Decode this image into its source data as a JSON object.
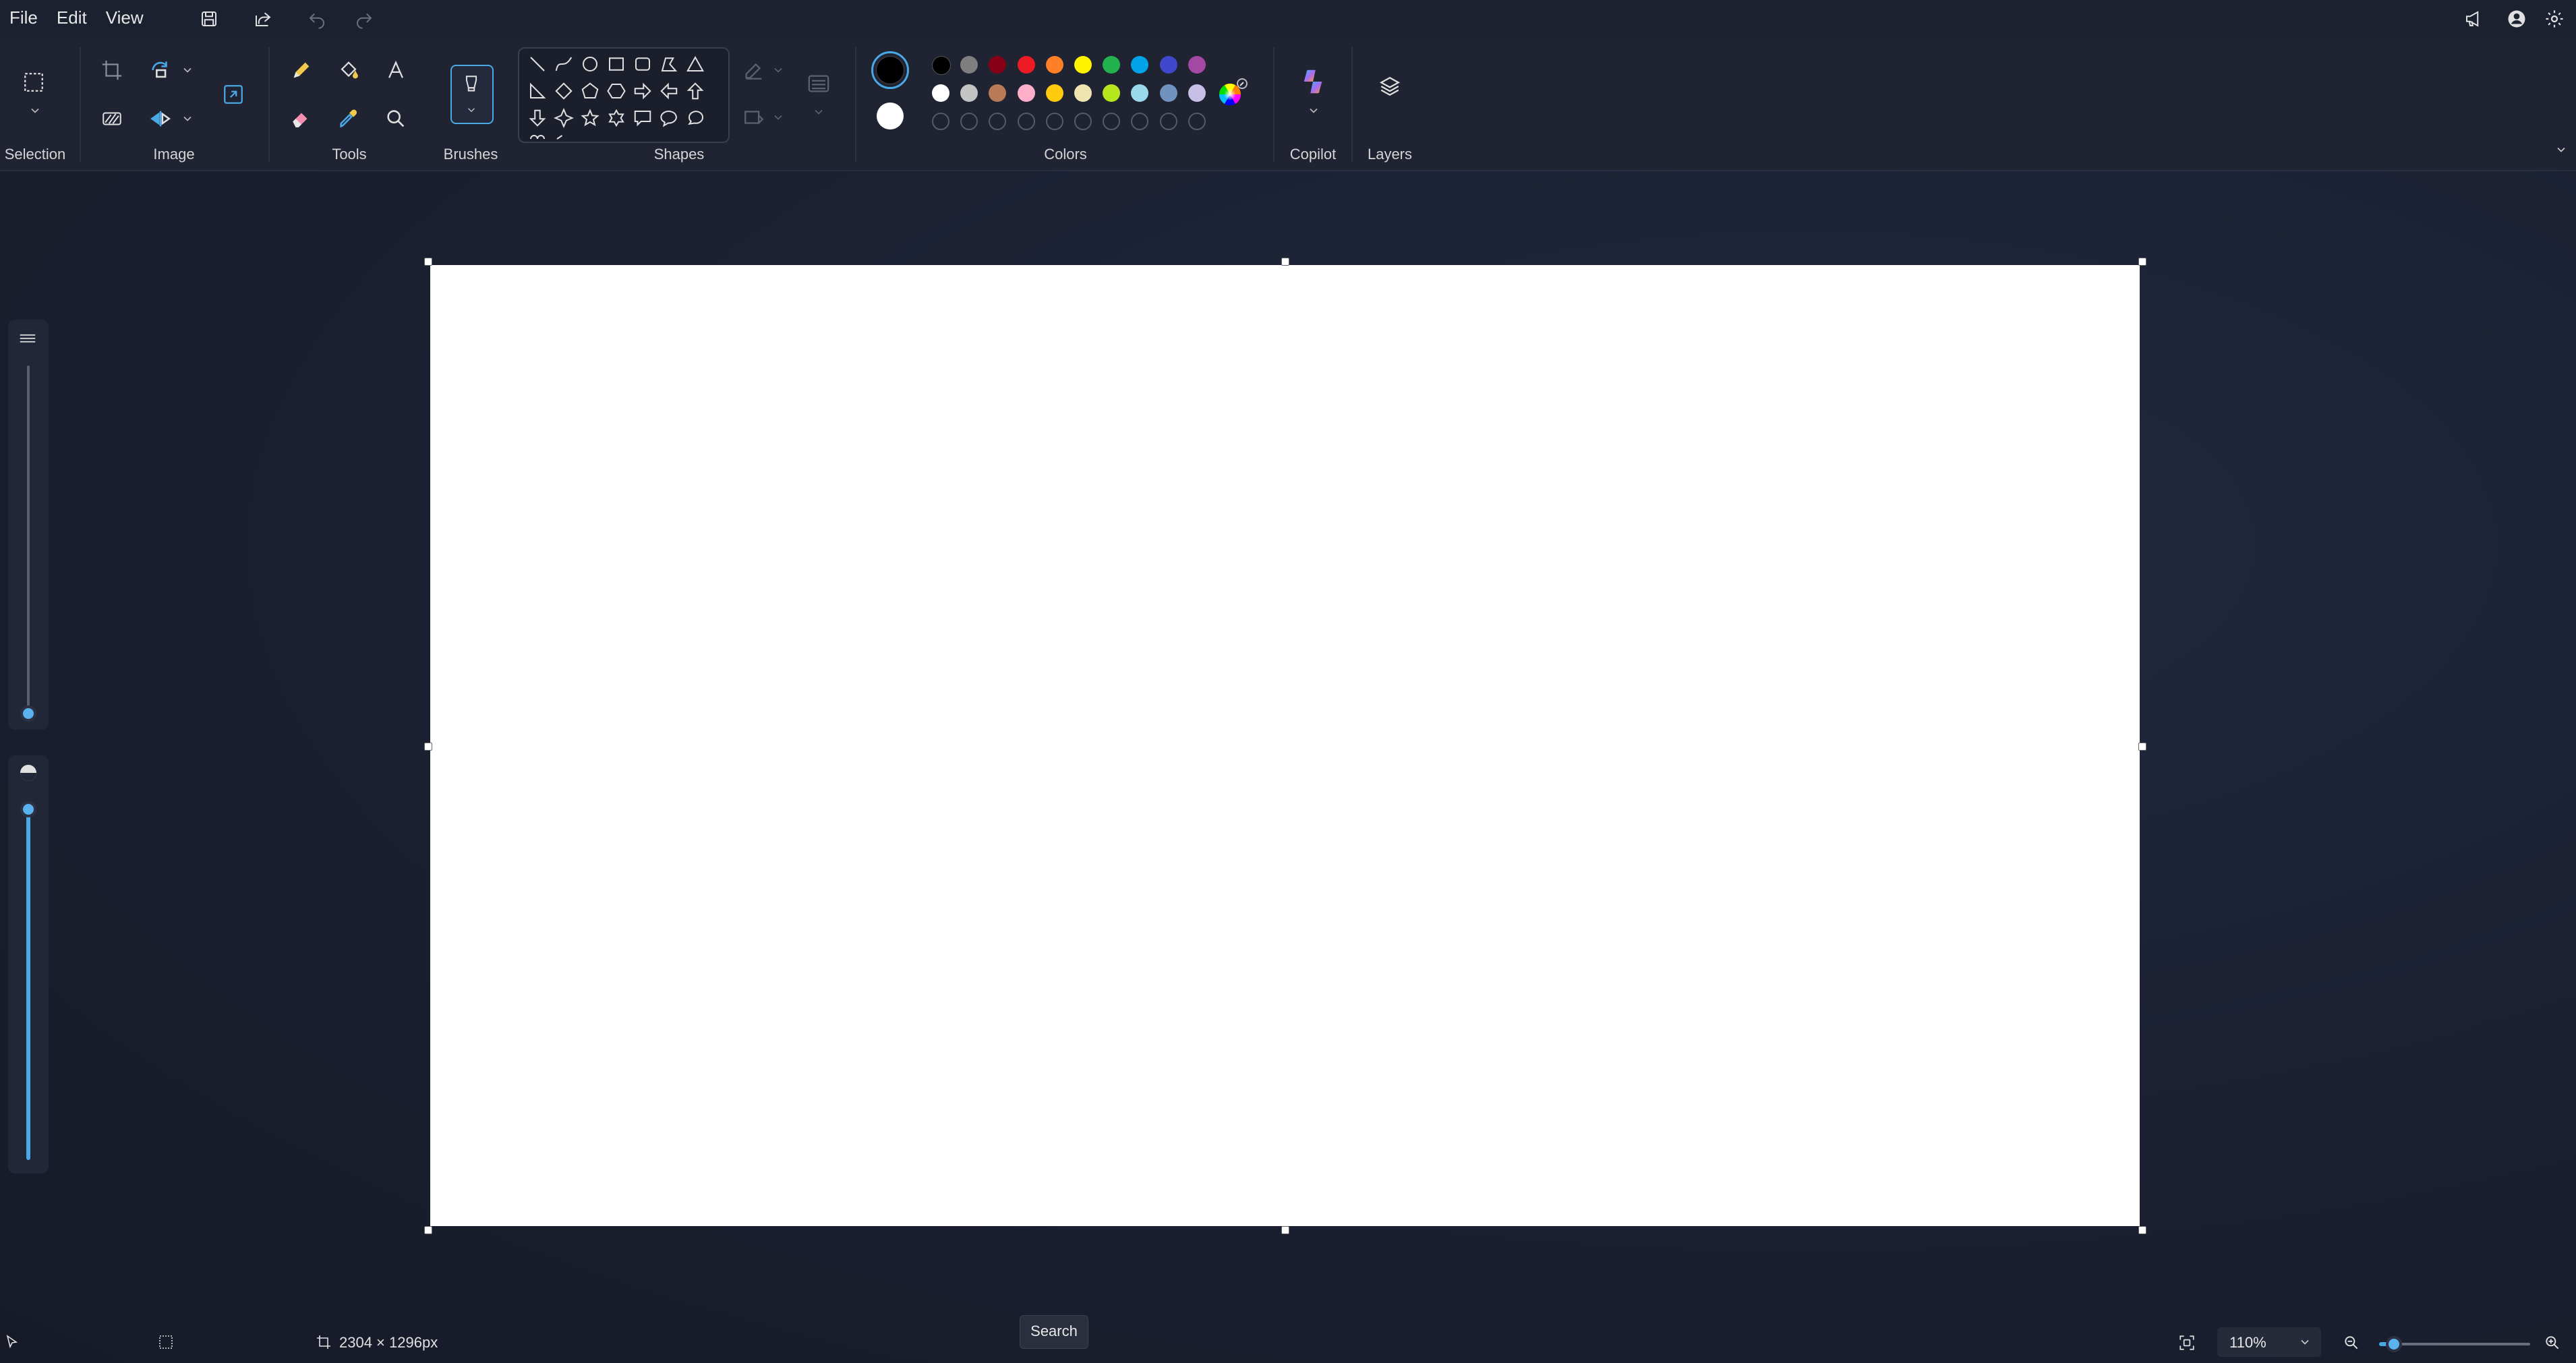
{
  "menu": {
    "file": "File",
    "edit": "Edit",
    "view": "View"
  },
  "ribbon": {
    "selection_label": "Selection",
    "image_label": "Image",
    "tools_label": "Tools",
    "brushes_label": "Brushes",
    "shapes_label": "Shapes",
    "colors_label": "Colors",
    "copilot_label": "Copilot",
    "layers_label": "Layers"
  },
  "colors": {
    "primary": "#000000",
    "secondary": "#ffffff",
    "palette_row1": [
      "#000000",
      "#7f7f7f",
      "#880015",
      "#ed1c24",
      "#ff7f27",
      "#fff200",
      "#22b14c",
      "#00a2e8",
      "#3f48cc",
      "#a349a4"
    ],
    "palette_row2": [
      "#ffffff",
      "#c3c3c3",
      "#b97a57",
      "#ffaec9",
      "#ffc90e",
      "#efe4b0",
      "#b5e61d",
      "#99d9ea",
      "#7092be",
      "#c8bfe7"
    ],
    "custom_slots": 10,
    "accent": "#4aa8e6"
  },
  "status": {
    "canvas_size": "2304 × 1296px",
    "search_tooltip": "Search",
    "zoom": "110%",
    "zoom_slider_fraction": 0.1
  },
  "side_sliders": {
    "size_fraction": 0.0,
    "opacity_fraction": 1.0
  }
}
